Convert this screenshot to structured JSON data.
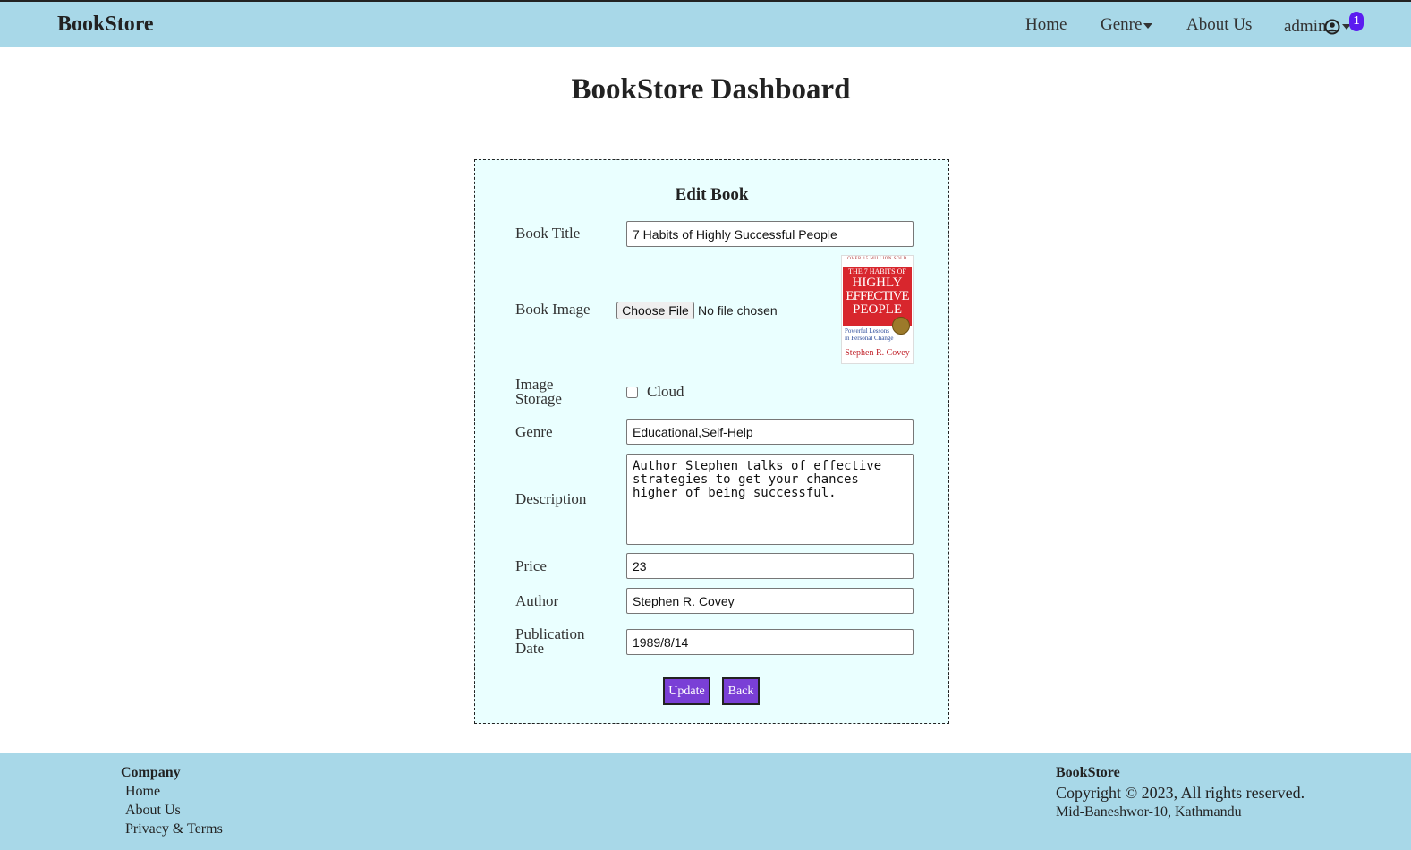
{
  "navbar": {
    "brand": "BookStore",
    "links": {
      "home": "Home",
      "genre": "Genre",
      "about": "About Us"
    },
    "user": {
      "name": "admin",
      "notification_count": "1",
      "icon": "user-circle-icon"
    },
    "colors": {
      "background": "#a8d8e8",
      "badge": "#5b1cf0"
    }
  },
  "page": {
    "title": "BookStore Dashboard"
  },
  "form": {
    "title": "Edit Book",
    "labels": {
      "book_title": "Book Title",
      "book_image": "Book Image",
      "image_storage_line1": "Image",
      "image_storage_line2": "Storage",
      "genre": "Genre",
      "description": "Description",
      "price": "Price",
      "author": "Author",
      "publication_date_line1": "Publication",
      "publication_date_line2": "Date"
    },
    "values": {
      "book_title": "7 Habits of Highly Successful People",
      "genre": "Educational,Self-Help",
      "description": "Author Stephen talks of effective strategies to get your chances higher of being successful.",
      "price": "23",
      "author": "Stephen R. Covey",
      "publication_date": "1989/8/14"
    },
    "file_input": {
      "button_label": "Choose File",
      "status": "No file chosen"
    },
    "cover_image": {
      "top": "OVER 15 MILLION SOLD",
      "line1": "THE 7 HABITS OF",
      "line2": "HIGHLY",
      "line3": "EFFECTIVE",
      "line4": "PEOPLE",
      "subtitle1": "Powerful Lessons",
      "subtitle2": "in Personal Change",
      "author": "Stephen R. Covey"
    },
    "storage_checkbox": {
      "label": "Cloud",
      "checked": false
    },
    "buttons": {
      "update": "Update",
      "back": "Back"
    },
    "colors": {
      "card_background": "#eaffff",
      "button": "#7a3fd6"
    }
  },
  "footer": {
    "company": {
      "heading": "Company",
      "links": [
        "Home",
        "About Us",
        "Privacy & Terms"
      ]
    },
    "brand": {
      "heading": "BookStore",
      "copyright": "Copyright © 2023, All rights reserved.",
      "address": "Mid-Baneshwor-10, Kathmandu"
    }
  }
}
